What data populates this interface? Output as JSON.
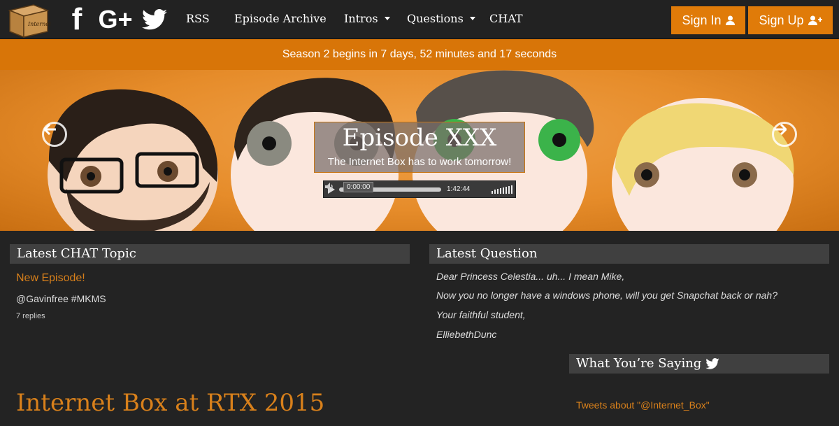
{
  "nav": {
    "logo_text": "Internet",
    "social": {
      "facebook": "f",
      "googleplus": "G+"
    },
    "links": [
      "RSS",
      "Episode Archive",
      "Intros",
      "Questions",
      "CHAT"
    ],
    "sign_in": "Sign In",
    "sign_up": "Sign Up",
    "icons": [
      "facebook-icon",
      "google-plus-icon",
      "twitter-icon",
      "user-icon",
      "user-plus-icon"
    ]
  },
  "countdown": "Season 2 begins in 7 days, 52 minutes and 17 seconds",
  "hero": {
    "title": "Episode XXX",
    "subtitle": "The Internet Box has to work tomorrow!",
    "player": {
      "current_time": "0:00:00",
      "duration": "1:42:44"
    }
  },
  "chat": {
    "heading": "Latest CHAT Topic",
    "topic": "New Episode!",
    "text": "@Gavinfree #MKMS",
    "replies": "7 replies"
  },
  "question": {
    "heading": "Latest Question",
    "lines": [
      "Dear Princess Celestia... uh... I mean Mike,",
      "Now you no longer have a windows phone, will you get Snapchat back or nah?",
      "Your faithful student,",
      "ElliebethDunc"
    ]
  },
  "saying": {
    "heading": "What You’re Saying",
    "tweets_link": "Tweets about \"@Internet_Box\""
  },
  "rtx_title": "Internet Box at RTX 2015",
  "colors": {
    "accent": "#e07b09",
    "bg": "#232323",
    "panel": "#404040",
    "link": "#d8801b"
  }
}
